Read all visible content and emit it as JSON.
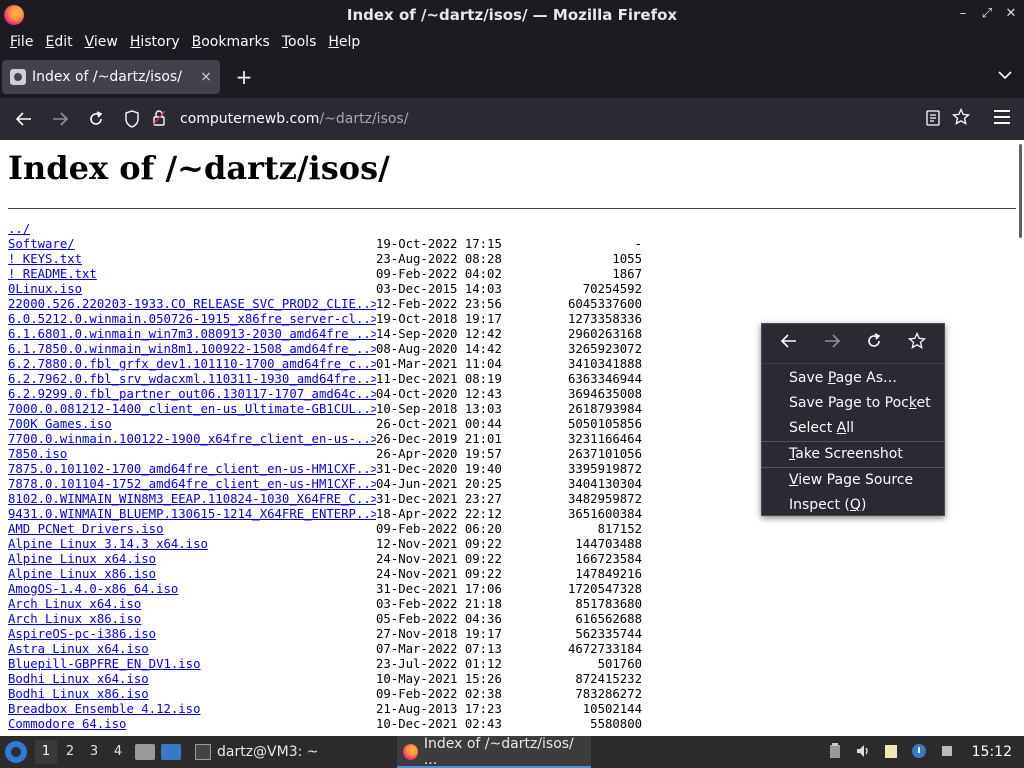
{
  "window": {
    "title": "Index of /~dartz/isos/ — Mozilla Firefox",
    "controls": [
      "–",
      "⤢",
      "✕"
    ]
  },
  "menubar": [
    {
      "label": "File"
    },
    {
      "label": "Edit"
    },
    {
      "label": "View"
    },
    {
      "label": "History"
    },
    {
      "label": "Bookmarks"
    },
    {
      "label": "Tools"
    },
    {
      "label": "Help"
    }
  ],
  "tab": {
    "title": "Index of /~dartz/isos/",
    "close": "×",
    "new": "+",
    "list": "⌄"
  },
  "navbar": {
    "url_host": "computernewb.com",
    "url_path": "/~dartz/isos/"
  },
  "page": {
    "heading": "Index of /~dartz/isos/",
    "rows": [
      {
        "name": "../",
        "date": "",
        "size": ""
      },
      {
        "name": "Software/",
        "date": "19-Oct-2022 17:15",
        "size": "-"
      },
      {
        "name": "! KEYS.txt",
        "date": "23-Aug-2022 08:28",
        "size": "1055"
      },
      {
        "name": "! README.txt",
        "date": "09-Feb-2022 04:02",
        "size": "1867"
      },
      {
        "name": "0Linux.iso",
        "date": "03-Dec-2015 14:03",
        "size": "70254592"
      },
      {
        "name": "22000.526.220203-1933.CO_RELEASE_SVC_PROD2_CLIE..>",
        "date": "12-Feb-2022 23:56",
        "size": "6045337600"
      },
      {
        "name": "6.0.5212.0.winmain.050726-1915_x86fre_server-cl..>",
        "date": "19-Oct-2018 19:17",
        "size": "1273358336"
      },
      {
        "name": "6.1.6801.0.winmain_win7m3.080913-2030_amd64fre_..>",
        "date": "14-Sep-2020 12:42",
        "size": "2960263168"
      },
      {
        "name": "6.1.7850.0.winmain_win8m1.100922-1508_amd64fre_..>",
        "date": "08-Aug-2020 14:42",
        "size": "3265923072"
      },
      {
        "name": "6.2.7880.0.fbl_grfx_dev1.101110-1700_amd64fre_c..>",
        "date": "01-Mar-2021 11:04",
        "size": "3410341888"
      },
      {
        "name": "6.2.7962.0.fbl_srv_wdacxml.110311-1930_amd64fre..>",
        "date": "11-Dec-2021 08:19",
        "size": "6363346944"
      },
      {
        "name": "6.2.9299.0.fbl_partner_out06.130117-1707_amd64c..>",
        "date": "04-Oct-2020 12:43",
        "size": "3694635008"
      },
      {
        "name": "7000.0.081212-1400_client_en-us_Ultimate-GB1CUL..>",
        "date": "10-Sep-2018 13:03",
        "size": "2618793984"
      },
      {
        "name": "700K Games.iso",
        "date": "26-Oct-2021 00:44",
        "size": "5050105856"
      },
      {
        "name": "7700.0.winmain.100122-1900_x64fre_client_en-us-..>",
        "date": "26-Dec-2019 21:01",
        "size": "3231166464"
      },
      {
        "name": "7850.iso",
        "date": "26-Apr-2020 19:57",
        "size": "2637101056"
      },
      {
        "name": "7875.0.101102-1700_amd64fre_client_en-us-HM1CXF..>",
        "date": "31-Dec-2020 19:40",
        "size": "3395919872"
      },
      {
        "name": "7878.0.101104-1752_amd64fre_client_en-us-HM1CXF..>",
        "date": "04-Jun-2021 20:25",
        "size": "3404130304"
      },
      {
        "name": "8102.0.WINMAIN_WIN8M3_EEAP.110824-1030_X64FRE_C..>",
        "date": "31-Dec-2021 23:27",
        "size": "3482959872"
      },
      {
        "name": "9431.0.WINMAIN_BLUEMP.130615-1214_X64FRE_ENTERP..>",
        "date": "18-Apr-2022 22:12",
        "size": "3651600384"
      },
      {
        "name": "AMD PCNet Drivers.iso",
        "date": "09-Feb-2022 06:20",
        "size": "817152"
      },
      {
        "name": "Alpine Linux 3.14.3 x64.iso",
        "date": "12-Nov-2021 09:22",
        "size": "144703488"
      },
      {
        "name": "Alpine Linux x64.iso",
        "date": "24-Nov-2021 09:22",
        "size": "166723584"
      },
      {
        "name": "Alpine Linux x86.iso",
        "date": "24-Nov-2021 09:22",
        "size": "147849216"
      },
      {
        "name": "AmogOS-1.4.0-x86_64.iso",
        "date": "31-Dec-2021 17:06",
        "size": "1720547328"
      },
      {
        "name": "Arch Linux x64.iso",
        "date": "03-Feb-2022 21:18",
        "size": "851783680"
      },
      {
        "name": "Arch Linux x86.iso",
        "date": "05-Feb-2022 04:36",
        "size": "616562688"
      },
      {
        "name": "AspireOS-pc-i386.iso",
        "date": "27-Nov-2018 19:17",
        "size": "562335744"
      },
      {
        "name": "Astra Linux x64.iso",
        "date": "07-Mar-2022 07:13",
        "size": "4672733184"
      },
      {
        "name": "Bluepill-GBPFRE_EN_DV1.iso",
        "date": "23-Jul-2022 01:12",
        "size": "501760"
      },
      {
        "name": "Bodhi Linux x64.iso",
        "date": "10-May-2021 15:26",
        "size": "872415232"
      },
      {
        "name": "Bodhi Linux x86.iso",
        "date": "09-Feb-2022 02:38",
        "size": "783286272"
      },
      {
        "name": "Breadbox Ensemble 4.12.iso",
        "date": "21-Aug-2013 17:23",
        "size": "10502144"
      },
      {
        "name": "Commodore 64.iso",
        "date": "10-Dec-2021 02:43",
        "size": "5580800"
      }
    ]
  },
  "context_menu": {
    "items": [
      {
        "label": "Save Page As…",
        "underline_index": 5
      },
      {
        "label": "Save Page to Pocket",
        "underline_index": 16
      },
      {
        "label": "Select All",
        "underline_index": 7
      },
      {
        "label": "Take Screenshot",
        "underline_index": 0
      },
      {
        "label": "View Page Source",
        "underline_index": 0
      },
      {
        "label": "Inspect (Q)",
        "underline_index": 9
      }
    ]
  },
  "taskbar": {
    "workspaces": [
      "1",
      "2",
      "3",
      "4"
    ],
    "tasks": [
      {
        "label": "dartz@VM3: ~"
      },
      {
        "label": "Index of /~dartz/isos/ ..."
      }
    ],
    "clock": "15:12"
  },
  "colors": {
    "link": "#0000ee",
    "chrome": "#1c1b22",
    "toolbar": "#2b2a33",
    "taskbar": "#2b2b2b"
  }
}
